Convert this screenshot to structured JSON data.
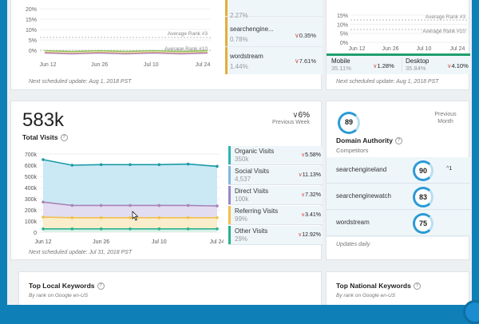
{
  "top_left": {
    "y_ticks": [
      "20%",
      "15%",
      "10%",
      "5%",
      "0%"
    ],
    "x_ticks": [
      "Jun 12",
      "Jun 26",
      "Jul 10",
      "Jul 24"
    ],
    "annotations": [
      "Average Rank #3",
      "Average Rank #10"
    ],
    "metrics": [
      {
        "label": "",
        "value": "2.27%",
        "delta": "",
        "color": "#e5ad3a"
      },
      {
        "label": "searchengine...",
        "value": "0.78%",
        "delta": "0.35%",
        "color": "#e5ad3a"
      },
      {
        "label": "wordstream",
        "value": "1.44%",
        "delta": "7.61%",
        "color": "#e5ad3a"
      }
    ],
    "note": "Next scheduled update: Aug 1, 2018 PST"
  },
  "top_right": {
    "y_ticks": [
      "15%",
      "10%",
      "5%",
      "0%"
    ],
    "x_ticks": [
      "Jun 12",
      "Jun 26",
      "Jul 10",
      "Jul 24"
    ],
    "annotations": [
      "Average Rank #3",
      "Average Rank #10"
    ],
    "mobile": {
      "label": "Mobile",
      "value": "35.11%",
      "delta": "1.28%"
    },
    "desktop": {
      "label": "Desktop",
      "value": "35.84%",
      "delta": "4.10%"
    },
    "note": "Next scheduled update: Aug 1, 2018 PST"
  },
  "visits": {
    "total": "583k",
    "total_label": "Total Visits",
    "change": "6%",
    "change_label": "Previous Week",
    "note": "Next scheduled update: Jul 31, 2018 PST",
    "metrics": [
      {
        "label": "Organic Visits",
        "value": "350k",
        "delta": "5.58%",
        "color": "#2fb3b5"
      },
      {
        "label": "Social Visits",
        "value": "4,537",
        "delta": "11.13%",
        "color": "#7fb8d8"
      },
      {
        "label": "Direct Visits",
        "value": "100k",
        "delta": "7.32%",
        "color": "#9a86c9"
      },
      {
        "label": "Referring Visits",
        "value": "99%",
        "delta": "3.41%",
        "color": "#f1c04f"
      },
      {
        "label": "Other Visits",
        "value": "29%",
        "delta": "12.92%",
        "color": "#2bb08d"
      }
    ]
  },
  "chart_data": {
    "type": "area",
    "x": [
      "Jun 12",
      "Jun 19",
      "Jun 26",
      "Jul 3",
      "Jul 10",
      "Jul 17",
      "Jul 24"
    ],
    "y_ticks": [
      "700k",
      "600k",
      "500k",
      "400k",
      "300k",
      "200k",
      "100k",
      "0"
    ],
    "x_ticks": [
      "Jun 12",
      "Jun 26",
      "Jul 10",
      "Jul 24"
    ],
    "ylim": [
      0,
      700000
    ],
    "series": [
      {
        "name": "Organic Visits",
        "color": "#1a9aa5",
        "fill": "#c8e8f4",
        "values": [
          650000,
          600000,
          605000,
          605000,
          605000,
          610000,
          590000
        ]
      },
      {
        "name": "Direct Visits",
        "color": "#a884b8",
        "fill": "#e4dcf0",
        "values": [
          270000,
          240000,
          240000,
          240000,
          240000,
          240000,
          235000
        ]
      },
      {
        "name": "Referring Visits",
        "color": "#f0c050",
        "fill": "#fbedc8",
        "values": [
          135000,
          130000,
          130000,
          130000,
          130000,
          130000,
          130000
        ]
      },
      {
        "name": "Other Visits",
        "color": "#2bb08d",
        "fill": "#d9f1e8",
        "values": [
          30000,
          30000,
          30000,
          30000,
          30000,
          30000,
          30000
        ]
      }
    ]
  },
  "domain": {
    "score": "89",
    "label": "Domain Authority",
    "sublabel": "Competitors",
    "prev": "Previous Month",
    "competitors": [
      {
        "name": "searchengineland",
        "score": "90",
        "delta": "1"
      },
      {
        "name": "searchenginewatch",
        "score": "83",
        "delta": ""
      },
      {
        "name": "wordstream",
        "score": "75",
        "delta": ""
      }
    ],
    "note": "Updates daily"
  },
  "local_keywords": {
    "title": "Top Local Keywords",
    "sub": "By rank on Google en-US"
  },
  "national_keywords": {
    "title": "Top National Keywords",
    "sub": "By rank on Google en-US"
  }
}
